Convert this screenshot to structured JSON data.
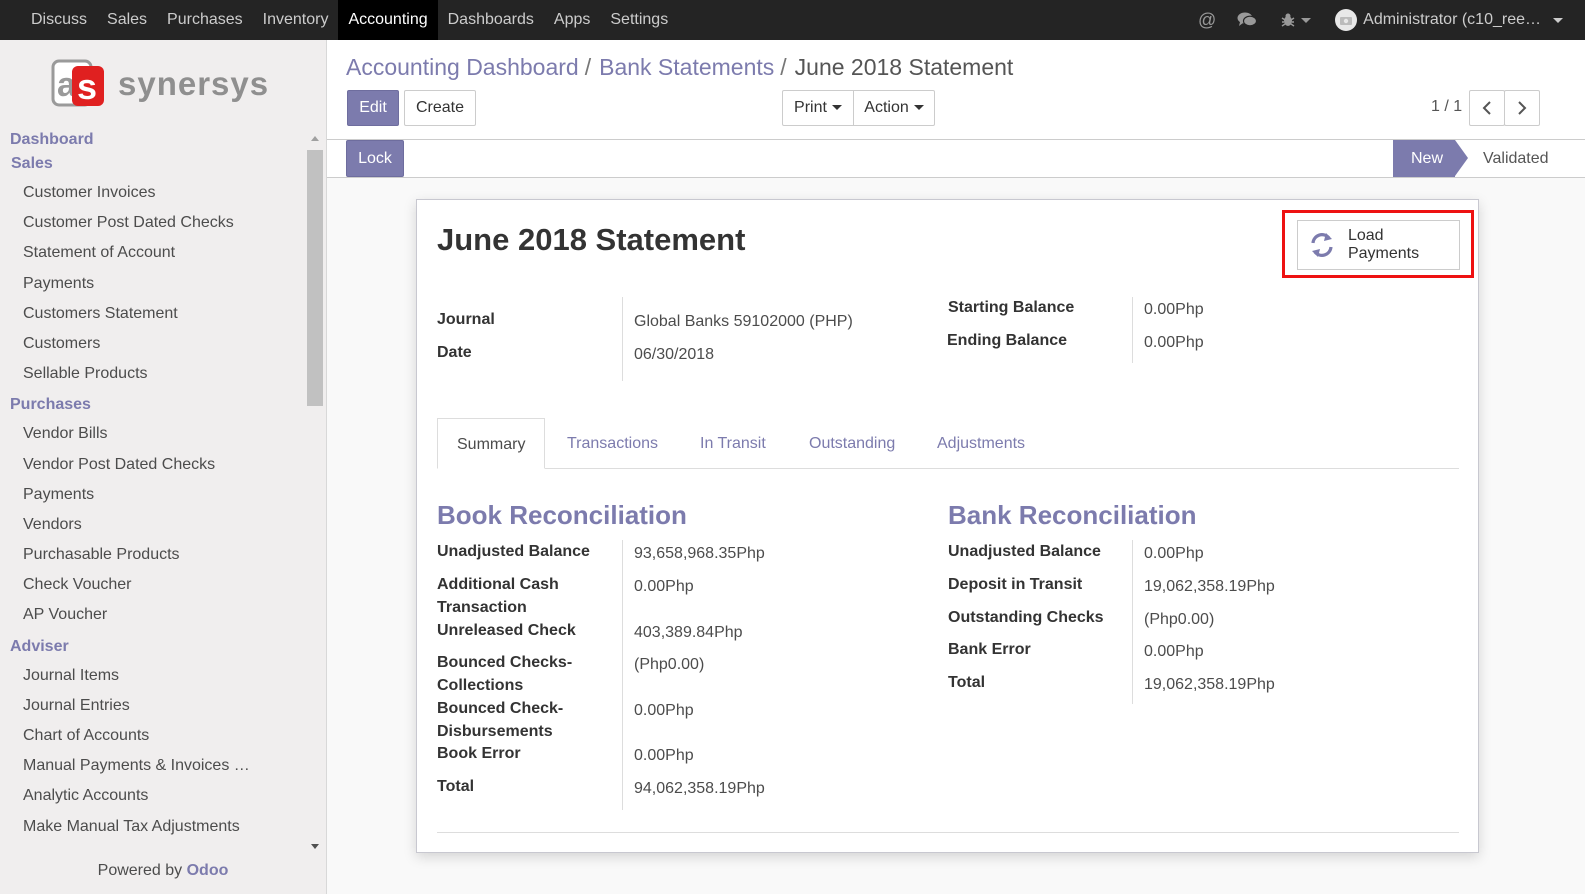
{
  "topnav": {
    "items": [
      "Discuss",
      "Sales",
      "Purchases",
      "Inventory",
      "Accounting",
      "Dashboards",
      "Apps",
      "Settings"
    ],
    "active_index": 4,
    "user_label": "Administrator (c10_ree…"
  },
  "sidebar": {
    "logo_text": "synersys",
    "sections": [
      {
        "title": "Dashboard",
        "items": []
      },
      {
        "title": "Sales",
        "items": [
          "Customer Invoices",
          "Customer Post Dated Checks",
          "Statement of Account",
          "Payments",
          "Customers Statement",
          "Customers",
          "Sellable Products"
        ]
      },
      {
        "title": "Purchases",
        "items": [
          "Vendor Bills",
          "Vendor Post Dated Checks",
          "Payments",
          "Vendors",
          "Purchasable Products",
          "Check Voucher",
          "AP Voucher"
        ]
      },
      {
        "title": "Adviser",
        "items": [
          "Journal Items",
          "Journal Entries",
          "Chart of Accounts",
          "Manual Payments & Invoices …",
          "Analytic Accounts",
          "Make Manual Tax Adjustments"
        ]
      }
    ],
    "powered_prefix": "Powered by",
    "powered_brand": "Odoo"
  },
  "breadcrumb": {
    "items": [
      "Accounting Dashboard",
      "Bank Statements"
    ],
    "current": "June 2018 Statement"
  },
  "buttons": {
    "edit": "Edit",
    "create": "Create",
    "print": "Print",
    "action": "Action",
    "lock": "Lock",
    "load_payments": "Load Payments"
  },
  "pager": {
    "text": "1 / 1"
  },
  "status": {
    "stages": [
      "New",
      "Validated"
    ],
    "active": "New"
  },
  "form": {
    "title": "June 2018 Statement",
    "journal_label": "Journal",
    "journal_value": "Global Banks 59102000 (PHP)",
    "date_label": "Date",
    "date_value": "06/30/2018",
    "starting_balance_label": "Starting Balance",
    "starting_balance_value": "0.00Php",
    "ending_balance_label": "Ending Balance",
    "ending_balance_value": "0.00Php"
  },
  "tabs": [
    "Summary",
    "Transactions",
    "In Transit",
    "Outstanding",
    "Adjustments"
  ],
  "book": {
    "title": "Book Reconciliation",
    "rows": [
      {
        "label": "Unadjusted Balance",
        "value": "93,658,968.35Php"
      },
      {
        "label": "Additional Cash Transaction",
        "value": "0.00Php"
      },
      {
        "label": "Unreleased Check",
        "value": "403,389.84Php"
      },
      {
        "label": "Bounced Checks-Collections",
        "value": "(Php0.00)"
      },
      {
        "label": "Bounced Check-Disbursements",
        "value": "0.00Php"
      },
      {
        "label": "Book Error",
        "value": "0.00Php"
      },
      {
        "label": "Total",
        "value": "94,062,358.19Php"
      }
    ]
  },
  "bank": {
    "title": "Bank Reconciliation",
    "rows": [
      {
        "label": "Unadjusted Balance",
        "value": "0.00Php"
      },
      {
        "label": "Deposit in Transit",
        "value": "19,062,358.19Php"
      },
      {
        "label": "Outstanding Checks",
        "value": "(Php0.00)"
      },
      {
        "label": "Bank Error",
        "value": "0.00Php"
      },
      {
        "label": "Total",
        "value": "19,062,358.19Php"
      }
    ]
  },
  "colors": {
    "accent": "#7c7bad",
    "topbar": "#242424",
    "highlight": "#ee1111"
  }
}
